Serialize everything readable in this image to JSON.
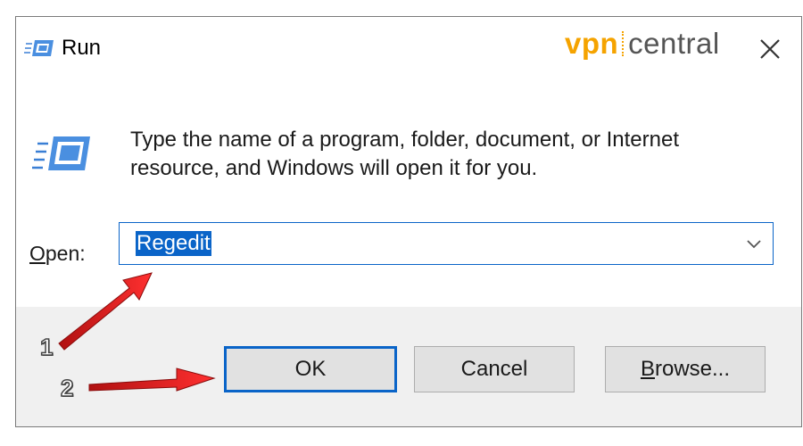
{
  "window": {
    "title": "Run",
    "close_glyph": "✕"
  },
  "branding": {
    "vpn": "vpn",
    "central": "central",
    "accent_color": "#f5a300"
  },
  "dialog": {
    "message": "Type the name of a program, folder, document, or Internet resource, and Windows will open it for you.",
    "open_label_access": "O",
    "open_label_rest": "pen:",
    "open_value": "Regedit"
  },
  "buttons": {
    "ok": "OK",
    "cancel": "Cancel",
    "browse_access": "B",
    "browse_rest": "rowse..."
  },
  "annotations": {
    "step1": "1",
    "step2": "2",
    "arrow_color": "#e11e1e"
  },
  "icons": {
    "title": "run-app-icon",
    "large": "run-app-icon",
    "close": "close-icon",
    "dropdown": "chevron-down-icon"
  }
}
